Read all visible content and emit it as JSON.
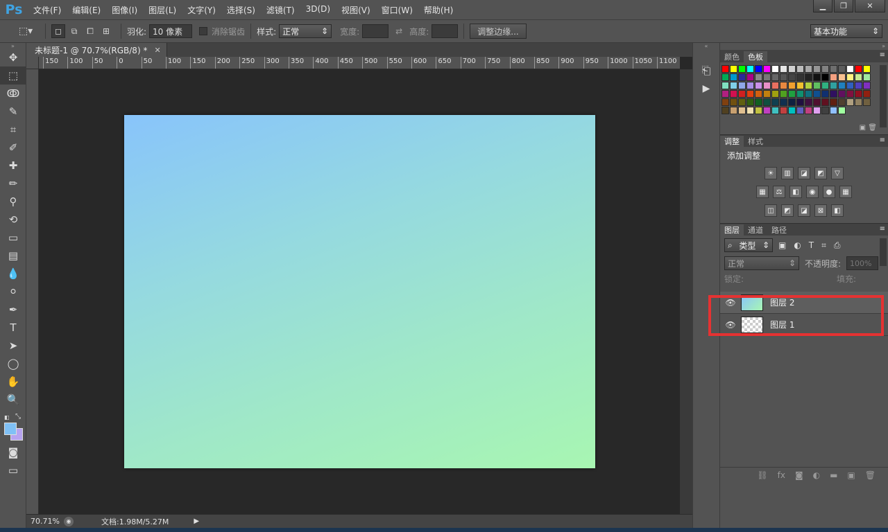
{
  "app": {
    "logo": "Ps"
  },
  "menu": [
    "文件(F)",
    "编辑(E)",
    "图像(I)",
    "图层(L)",
    "文字(Y)",
    "选择(S)",
    "滤镜(T)",
    "3D(D)",
    "视图(V)",
    "窗口(W)",
    "帮助(H)"
  ],
  "window_buttons": {
    "minimize": "▁",
    "restore": "❐",
    "close": "✕"
  },
  "options": {
    "feather_label": "羽化:",
    "feather_value": "10 像素",
    "antialias_label": "消除锯齿",
    "style_label": "样式:",
    "style_value": "正常",
    "width_label": "宽度:",
    "height_label": "高度:",
    "refine_edge": "调整边缘...",
    "workspace": "基本功能"
  },
  "document": {
    "tab_title": "未标题-1 @ 70.7%(RGB/8) *",
    "ruler_ticks": [
      "150",
      "100",
      "50",
      "0",
      "50",
      "100",
      "150",
      "200",
      "250",
      "300",
      "350",
      "400",
      "450",
      "500",
      "550",
      "600",
      "650",
      "700",
      "750",
      "800",
      "850",
      "900",
      "950",
      "1000",
      "1050",
      "1100"
    ],
    "zoom": "70.71%",
    "doc_info": "文档:1.98M/5.27M"
  },
  "panels": {
    "color_tab": "颜色",
    "swatches_tab": "色板",
    "adjustments_tab": "调整",
    "styles_tab": "样式",
    "add_adjustment": "添加调整",
    "layers_tab": "图层",
    "channels_tab": "通道",
    "paths_tab": "路径",
    "filter_kind": "类型",
    "blend_mode": "正常",
    "opacity_label": "不透明度:",
    "opacity_value": "100%",
    "lock_label": "锁定:",
    "fill_label": "填充:"
  },
  "layers": [
    {
      "name": "图层 2",
      "selected": true
    },
    {
      "name": "图层 1",
      "selected": false
    }
  ],
  "colors": {
    "canvas_gradient_start": "#88c4fb",
    "canvas_gradient_end": "#a8f6b2",
    "highlight": "#e53232",
    "foreground": "#7fc0f5",
    "background": "#b7a3f0"
  },
  "swatches": [
    "#ff0000",
    "#ffff00",
    "#00ff00",
    "#00ffff",
    "#0000ff",
    "#ff00ff",
    "#ffffff",
    "#e6e6e6",
    "#d0d0d0",
    "#bcbcbc",
    "#a8a8a8",
    "#959595",
    "#818181",
    "#6e6e6e",
    "#5c5c5c",
    "#ffffff",
    "#ff0000",
    "#ffff00",
    "#00aa55",
    "#0099cc",
    "#2a2a9a",
    "#aa0088",
    "#888888",
    "#777777",
    "#666666",
    "#555555",
    "#444444",
    "#333333",
    "#222222",
    "#111111",
    "#000000",
    "#f4a080",
    "#f8c090",
    "#fff080",
    "#c8e890",
    "#a0e8a0",
    "#80e0c0",
    "#80d0e8",
    "#90a8e8",
    "#a890e8",
    "#c890e8",
    "#e890c8",
    "#e87060",
    "#e88840",
    "#f0a030",
    "#f0c030",
    "#b0d040",
    "#60c060",
    "#30b080",
    "#30a0a0",
    "#2080c0",
    "#3060c0",
    "#5040c0",
    "#8030c0",
    "#b02080",
    "#d01050",
    "#d02020",
    "#e04010",
    "#d06010",
    "#c08010",
    "#a0a010",
    "#50a020",
    "#20a040",
    "#109070",
    "#107080",
    "#105090",
    "#103070",
    "#301060",
    "#601060",
    "#801040",
    "#901020",
    "#902010",
    "#804010",
    "#705010",
    "#606010",
    "#306010",
    "#106020",
    "#105040",
    "#104050",
    "#103050",
    "#102040",
    "#201040",
    "#401040",
    "#501030",
    "#601020",
    "#602010",
    "#504030",
    "#b0a080",
    "#908060",
    "#706040",
    "#504020",
    "#c8a070",
    "#e0c090",
    "#f0e0b0",
    "#c0c040",
    "#c040c0",
    "#40c0c0",
    "#c04040",
    "#00c0c0",
    "#6060c0",
    "#c04080",
    "#e0a0f0",
    "#404040",
    "#90c0ff",
    "#a0ffa0"
  ],
  "adjustment_rows": [
    [
      "☀",
      "▥",
      "◪",
      "◩",
      "▽"
    ],
    [
      "▦",
      "⚖",
      "◧",
      "◉",
      "●",
      "▦"
    ],
    [
      "◫",
      "◩",
      "◪",
      "⊠",
      "◧"
    ]
  ],
  "tools": [
    "move-tool",
    "marquee-tool",
    "lasso-tool",
    "quick-select-tool",
    "crop-tool",
    "eyedropper-tool",
    "healing-tool",
    "brush-tool",
    "stamp-tool",
    "history-brush-tool",
    "eraser-tool",
    "gradient-tool",
    "blur-tool",
    "dodge-tool",
    "pen-tool",
    "type-tool",
    "path-select-tool",
    "shape-tool",
    "hand-tool",
    "zoom-tool"
  ],
  "tool_glyphs": [
    "✥",
    "⬚",
    "ↂ",
    "✎",
    "⌗",
    "✐",
    "✚",
    "✏",
    "⚲",
    "⟲",
    "▭",
    "▤",
    "💧",
    "⚪",
    "✒",
    "T",
    "➤",
    "◯",
    "✋",
    "🔍"
  ]
}
